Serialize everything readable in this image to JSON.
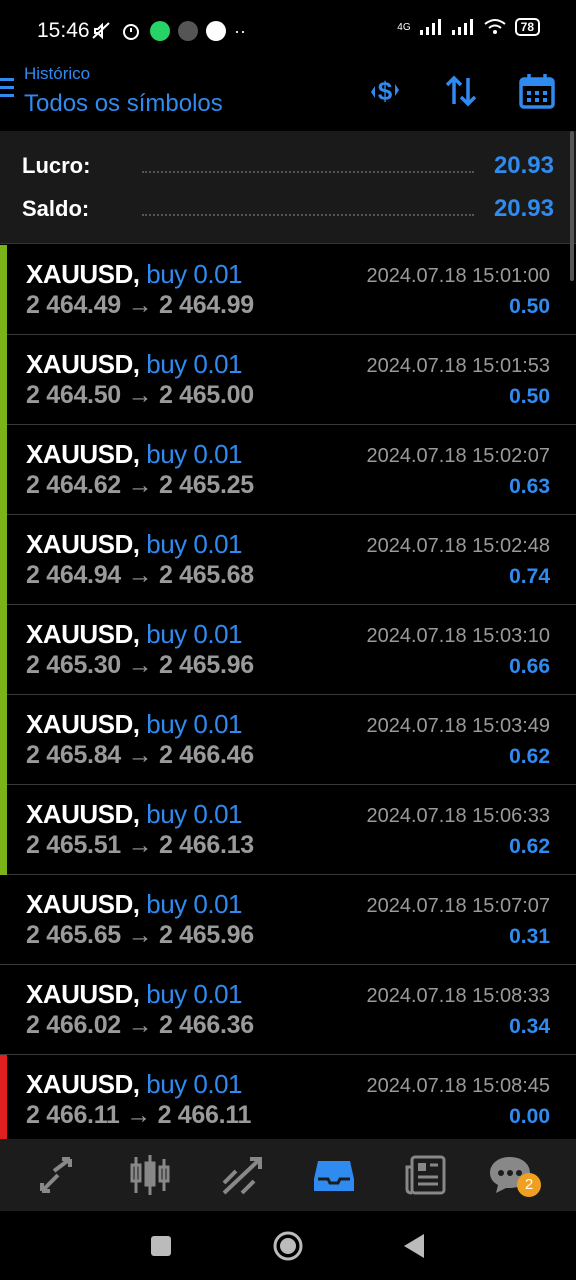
{
  "status_bar": {
    "time": "15:46",
    "network": "4G",
    "battery": "78"
  },
  "header": {
    "subtitle": "Histórico",
    "title": "Todos os símbolos",
    "icons": [
      "currency-filter-icon",
      "sort-icon",
      "calendar-icon"
    ],
    "accent_color": "#2f8bf0"
  },
  "summary": {
    "profit_label": "Lucro:",
    "profit_value": "20.93",
    "balance_label": "Saldo:",
    "balance_value": "20.93"
  },
  "trades": [
    {
      "symbol": "XAUUSD,",
      "side": "buy 0.01",
      "open": "2 464.49",
      "arrow": "→",
      "close": "2 464.99",
      "time": "2024.07.18 15:01:00",
      "profit": "0.50",
      "indicator": "#7ab317"
    },
    {
      "symbol": "XAUUSD,",
      "side": "buy 0.01",
      "open": "2 464.50",
      "arrow": "→",
      "close": "2 465.00",
      "time": "2024.07.18 15:01:53",
      "profit": "0.50",
      "indicator": "#7ab317"
    },
    {
      "symbol": "XAUUSD,",
      "side": "buy 0.01",
      "open": "2 464.62",
      "arrow": "→",
      "close": "2 465.25",
      "time": "2024.07.18 15:02:07",
      "profit": "0.63",
      "indicator": "#7ab317"
    },
    {
      "symbol": "XAUUSD,",
      "side": "buy 0.01",
      "open": "2 464.94",
      "arrow": "→",
      "close": "2 465.68",
      "time": "2024.07.18 15:02:48",
      "profit": "0.74",
      "indicator": "#7ab317"
    },
    {
      "symbol": "XAUUSD,",
      "side": "buy 0.01",
      "open": "2 465.30",
      "arrow": "→",
      "close": "2 465.96",
      "time": "2024.07.18 15:03:10",
      "profit": "0.66",
      "indicator": "#7ab317"
    },
    {
      "symbol": "XAUUSD,",
      "side": "buy 0.01",
      "open": "2 465.84",
      "arrow": "→",
      "close": "2 466.46",
      "time": "2024.07.18 15:03:49",
      "profit": "0.62",
      "indicator": "#7ab317"
    },
    {
      "symbol": "XAUUSD,",
      "side": "buy 0.01",
      "open": "2 465.51",
      "arrow": "→",
      "close": "2 466.13",
      "time": "2024.07.18 15:06:33",
      "profit": "0.62",
      "indicator": "#7ab317"
    },
    {
      "symbol": "XAUUSD,",
      "side": "buy 0.01",
      "open": "2 465.65",
      "arrow": "→",
      "close": "2 465.96",
      "time": "2024.07.18 15:07:07",
      "profit": "0.31",
      "indicator": "none"
    },
    {
      "symbol": "XAUUSD,",
      "side": "buy 0.01",
      "open": "2 466.02",
      "arrow": "→",
      "close": "2 466.36",
      "time": "2024.07.18 15:08:33",
      "profit": "0.34",
      "indicator": "none"
    },
    {
      "symbol": "XAUUSD,",
      "side": "buy 0.01",
      "open": "2 466.11",
      "arrow": "→",
      "close": "2 466.11",
      "time": "2024.07.18 15:08:45",
      "profit": "0.00",
      "indicator": "#e02020"
    }
  ],
  "bottom_nav": {
    "items": [
      "quotes-icon",
      "chart-icon",
      "trade-icon",
      "history-icon",
      "news-icon",
      "messages-icon"
    ],
    "active": "history-icon",
    "messages_badge": "2"
  }
}
